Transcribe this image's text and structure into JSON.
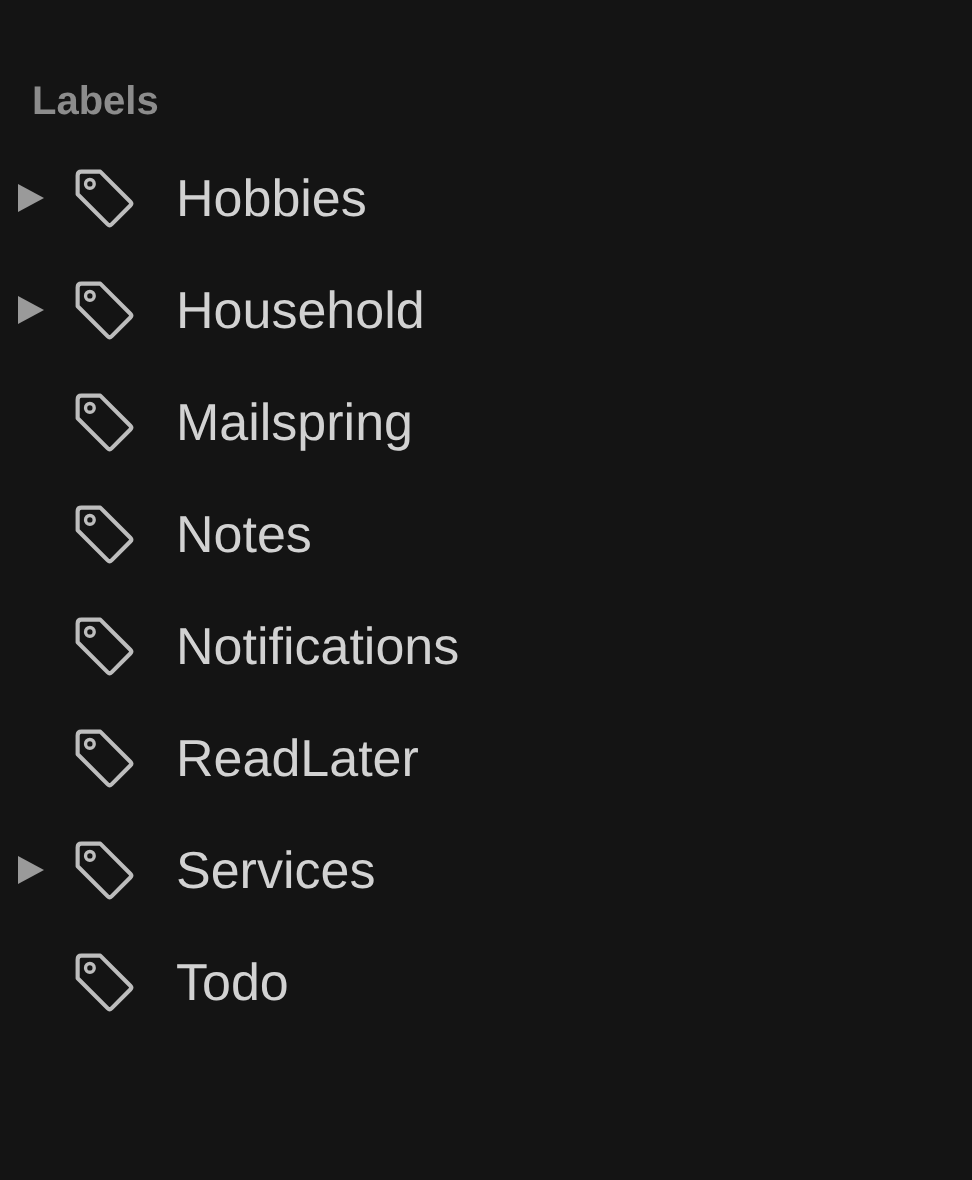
{
  "section": {
    "title": "Labels"
  },
  "labels": [
    {
      "kind": "parent",
      "label": "Hobbies",
      "expanded": false
    },
    {
      "kind": "parent",
      "label": "Household",
      "expanded": false
    },
    {
      "kind": "leaf",
      "label": "Mailspring"
    },
    {
      "kind": "leaf",
      "label": "Notes"
    },
    {
      "kind": "leaf",
      "label": "Notifications"
    },
    {
      "kind": "leaf",
      "label": "ReadLater"
    },
    {
      "kind": "parent",
      "label": "Services",
      "expanded": false
    },
    {
      "kind": "leaf",
      "label": "Todo"
    }
  ]
}
